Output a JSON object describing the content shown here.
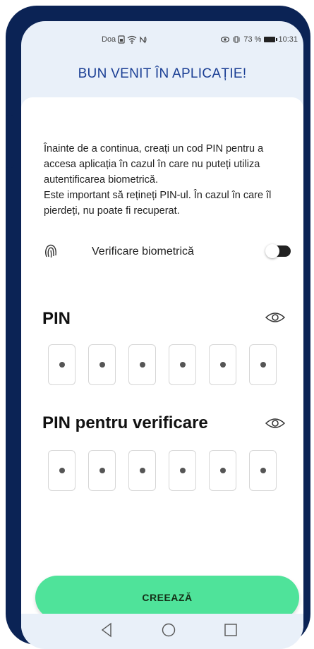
{
  "status_bar": {
    "left_text": "Doa",
    "battery": "73 %",
    "time": "10:31"
  },
  "header": {
    "title": "BUN VENIT ÎN APLICAȚIE!"
  },
  "intro": {
    "paragraph1": "Înainte de a continua, creați un cod PIN pentru a accesa aplicația în cazul în care nu puteți utiliza autentificarea biometrică.",
    "paragraph2": "Este important să rețineți PIN-ul. În cazul în care îl pierdeți, nu poate fi recuperat."
  },
  "biometric": {
    "label": "Verificare biometrică",
    "icon": "fingerprint-icon",
    "enabled": false
  },
  "pin": {
    "title": "PIN",
    "length": 6
  },
  "pin_verify": {
    "title": "PIN pentru verificare",
    "length": 6
  },
  "actions": {
    "create_label": "CREEAZĂ"
  },
  "colors": {
    "accent": "#4fe39a",
    "header_text": "#1a3e94",
    "frame": "#0b2355"
  }
}
